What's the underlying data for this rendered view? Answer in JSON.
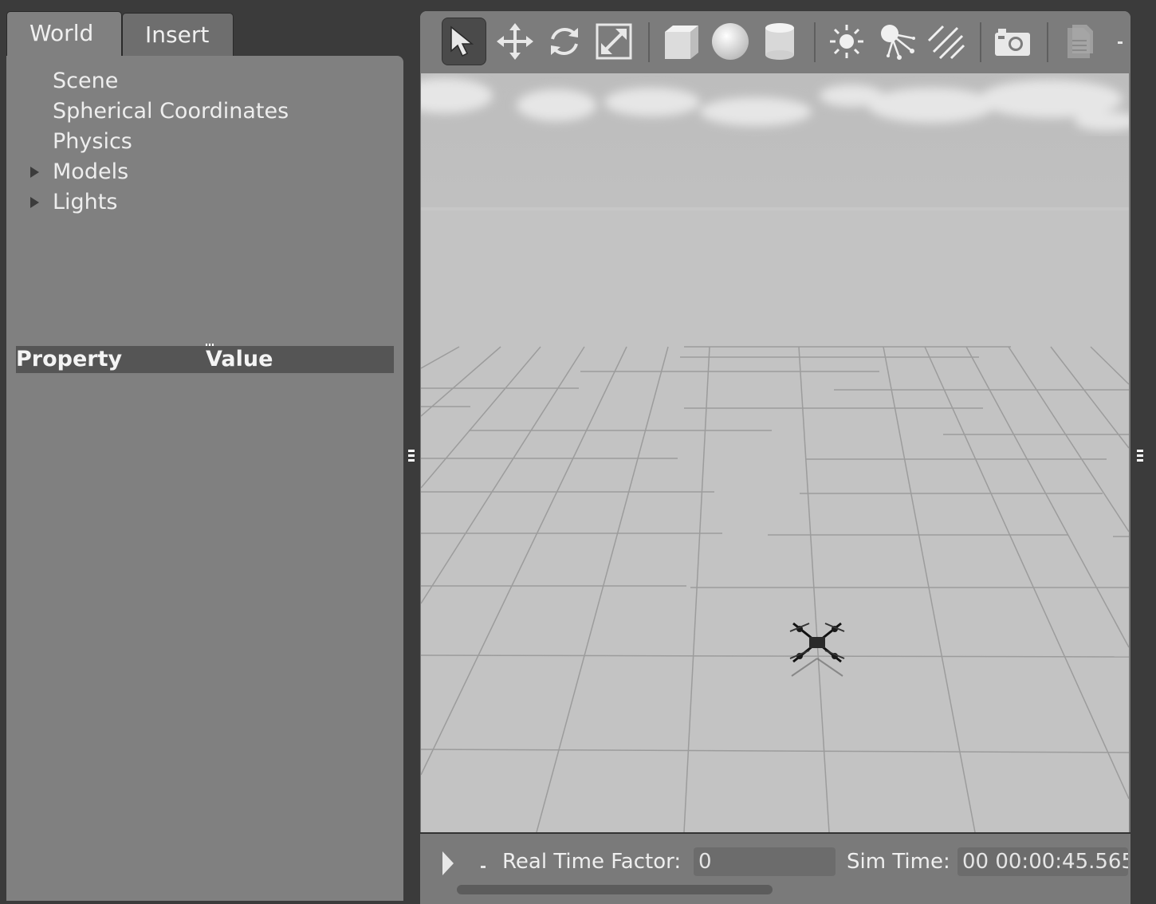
{
  "tabs": {
    "world": "World",
    "insert": "Insert"
  },
  "world_tree": [
    {
      "label": "Scene",
      "expandable": false
    },
    {
      "label": "Spherical Coordinates",
      "expandable": false
    },
    {
      "label": "Physics",
      "expandable": false
    },
    {
      "label": "Models",
      "expandable": true
    },
    {
      "label": "Lights",
      "expandable": true
    }
  ],
  "property_table": {
    "col_property": "Property",
    "col_value": "Value"
  },
  "toolbar": {
    "tools": [
      {
        "name": "select-mode-icon",
        "active": true
      },
      {
        "name": "translate-mode-icon",
        "active": false
      },
      {
        "name": "rotate-mode-icon",
        "active": false
      },
      {
        "name": "scale-mode-icon",
        "active": false
      },
      {
        "name": "box-shape-icon",
        "active": false
      },
      {
        "name": "sphere-shape-icon",
        "active": false
      },
      {
        "name": "cylinder-shape-icon",
        "active": false
      },
      {
        "name": "point-light-icon",
        "active": false
      },
      {
        "name": "spot-light-icon",
        "active": false
      },
      {
        "name": "directional-light-icon",
        "active": false
      },
      {
        "name": "screenshot-camera-icon",
        "active": false
      },
      {
        "name": "copy-icon",
        "active": false
      }
    ]
  },
  "status": {
    "rtf_label": "Real Time Factor:",
    "rtf_value": "0",
    "sim_label": "Sim Time:",
    "sim_value": "00 00:00:45.565"
  },
  "colors": {
    "panel": "#808080",
    "background": "#3b3b3b",
    "viewport_ground": "#c4c4c4",
    "header": "#555555"
  }
}
